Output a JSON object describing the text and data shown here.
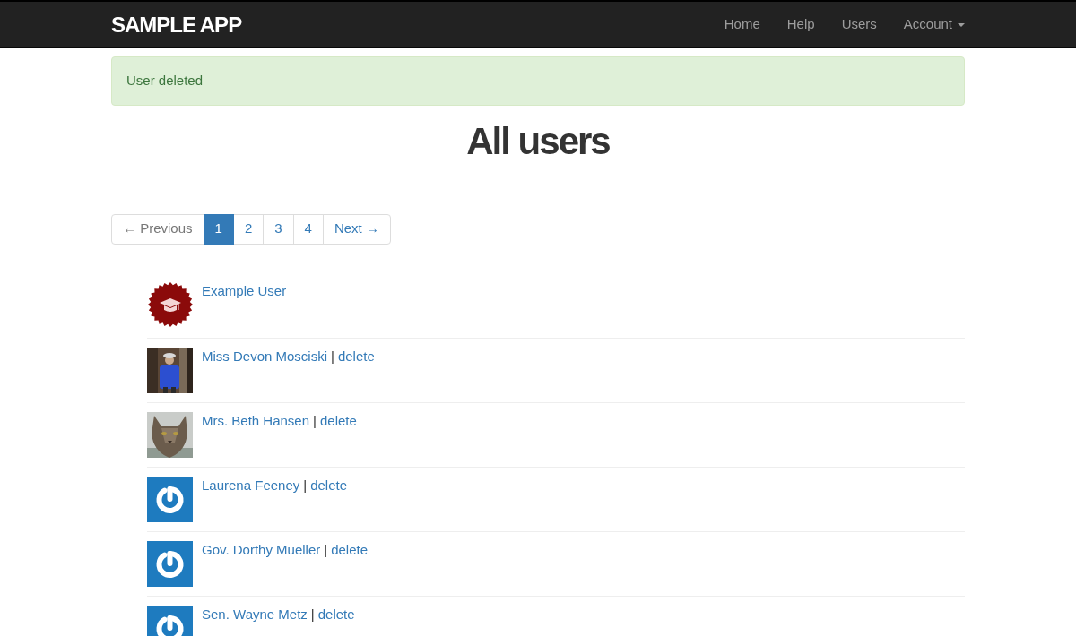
{
  "navbar": {
    "brand": "SAMPLE APP",
    "links": [
      {
        "label": "Home",
        "kind": "link"
      },
      {
        "label": "Help",
        "kind": "link"
      },
      {
        "label": "Users",
        "kind": "link"
      },
      {
        "label": "Account",
        "kind": "dropdown"
      }
    ]
  },
  "alert": {
    "text": "User deleted",
    "kind": "success"
  },
  "heading": "All users",
  "pagination": [
    {
      "label": "← Previous",
      "selected": false
    },
    {
      "label": "1",
      "selected": true
    },
    {
      "label": "2",
      "selected": false
    },
    {
      "label": "3",
      "selected": false
    },
    {
      "label": "4",
      "selected": false
    },
    {
      "label": "Next →",
      "selected": false
    }
  ],
  "users": [
    {
      "name": "Example User",
      "kind": "badge"
    },
    {
      "name": "Miss Devon Mosciski",
      "separator": "|",
      "action": "delete"
    },
    {
      "name": "Mrs. Beth Hansen",
      "kind": "pet",
      "separator": "|",
      "action": "delete"
    },
    {
      "name": "Laurena Feeney",
      "kind": "default",
      "separator": "|",
      "action": "delete"
    },
    {
      "name": "Gov. Dorthy Mueller",
      "kind": "default",
      "separator": "|",
      "action": "delete"
    },
    {
      "name": "Sen. Wayne Metz",
      "kind": "default",
      "separator": "|",
      "action": "delete"
    }
  ]
}
